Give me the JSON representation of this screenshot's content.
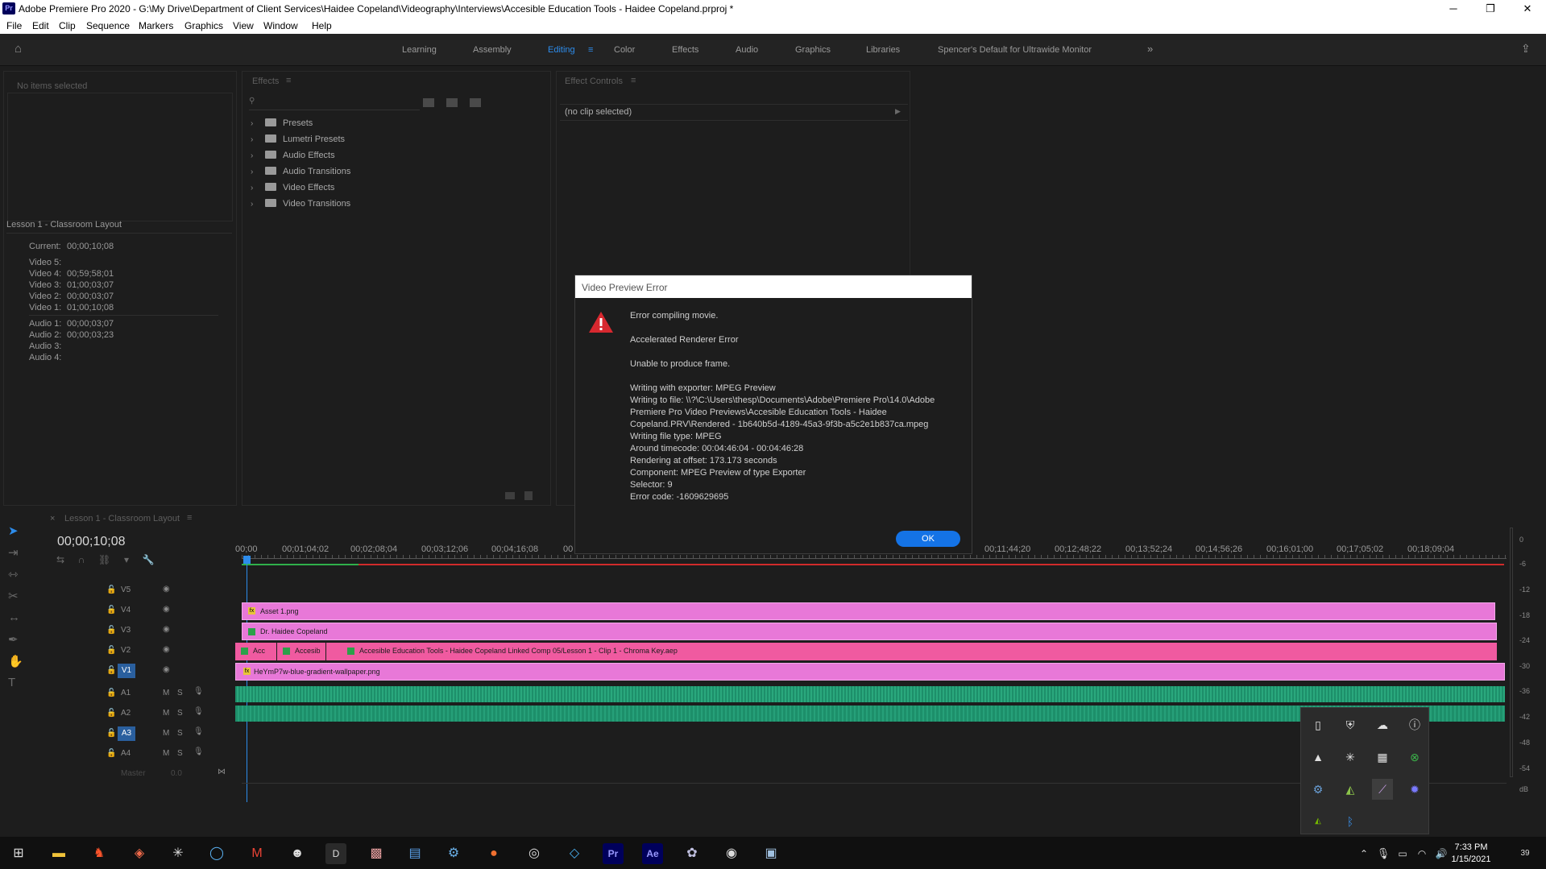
{
  "title_bar": {
    "app_icon": "Pr",
    "title": "Adobe Premiere Pro 2020 - G:\\My Drive\\Department of Client Services\\Haidee Copeland\\Videography\\Interviews\\Accesible Education Tools - Haidee Copeland.prproj *",
    "minimize": "─",
    "maximize": "❐",
    "close": "✕"
  },
  "menu": [
    "File",
    "Edit",
    "Clip",
    "Sequence",
    "Markers",
    "Graphics",
    "View",
    "Window",
    "Help"
  ],
  "workspaces": [
    "Learning",
    "Assembly",
    "Editing",
    "Color",
    "Effects",
    "Audio",
    "Graphics",
    "Libraries",
    "Spencer's Default for Ultrawide Monitor"
  ],
  "active_workspace": "Editing",
  "workspace_overflow": "»",
  "info_panel": {
    "no_items": "No items selected",
    "sequence_name": "Lesson 1 - Classroom Layout",
    "current_label": "Current:",
    "current_value": "00;00;10;08",
    "video": [
      {
        "label": "Video 5:",
        "value": ""
      },
      {
        "label": "Video 4:",
        "value": "00;59;58;01"
      },
      {
        "label": "Video 3:",
        "value": "01;00;03;07"
      },
      {
        "label": "Video 2:",
        "value": "00;00;03;07"
      },
      {
        "label": "Video 1:",
        "value": "01;00;10;08"
      }
    ],
    "audio": [
      {
        "label": "Audio 1:",
        "value": "00;00;03;07"
      },
      {
        "label": "Audio 2:",
        "value": "00;00;03;23"
      },
      {
        "label": "Audio 3:",
        "value": ""
      },
      {
        "label": "Audio 4:",
        "value": ""
      }
    ]
  },
  "effects_panel": {
    "title": "Effects",
    "items": [
      "Presets",
      "Lumetri Presets",
      "Audio Effects",
      "Audio Transitions",
      "Video Effects",
      "Video Transitions"
    ]
  },
  "effect_controls": {
    "title": "Effect Controls",
    "no_clip": "(no clip selected)"
  },
  "dialog": {
    "title": "Video Preview Error",
    "lines": [
      "Error compiling movie.",
      "Accelerated Renderer Error",
      "Unable to produce frame.",
      "Writing with exporter: MPEG Preview",
      "Writing to file: \\\\?\\C:\\Users\\thesp\\Documents\\Adobe\\Premiere Pro\\14.0\\Adobe",
      "Premiere Pro Video Previews\\Accesible Education Tools - Haidee",
      "Copeland.PRV\\Rendered - 1b640b5d-4189-45a3-9f3b-a5c2e1b837ca.mpeg",
      "Writing file type: MPEG",
      "Around timecode: 00:04:46:04 - 00:04:46:28",
      "Rendering at offset: 173.173 seconds",
      "Component: MPEG Preview of type Exporter",
      "Selector: 9",
      "Error code: -1609629695"
    ],
    "ok": "OK"
  },
  "timeline": {
    "tab": "Lesson 1 - Classroom Layout",
    "timecode": "00;00;10;08",
    "ruler": [
      "00;00",
      "00;01;04;02",
      "00;02;08;04",
      "00;03;12;06",
      "00;04;16;08",
      "00",
      "00;11;44;20",
      "00;12;48;22",
      "00;13;52;24",
      "00;14;56;26",
      "00;16;01;00",
      "00;17;05;02",
      "00;18;09;04"
    ],
    "video_tracks": [
      "V5",
      "V4",
      "V3",
      "V2",
      "V1"
    ],
    "audio_tracks": [
      "A1",
      "A2",
      "A3",
      "A4"
    ],
    "master": "Master",
    "master_value": "0.0",
    "clips": {
      "v4": "Asset 1.png",
      "v3": "Dr. Haidee Copeland",
      "v2a": "Acc",
      "v2b": "Accesib",
      "v2c": "Accesible Education Tools - Haidee Copeland Linked Comp 05/Lesson 1 - Clip 1 - Chroma Key.aep",
      "v1": "HeYmP7w-blue-gradient-wallpaper.png"
    },
    "meter_labels": [
      "0",
      "-6",
      "-12",
      "-18",
      "-24",
      "-30",
      "-36",
      "-42",
      "-48",
      "-54",
      "dB"
    ]
  },
  "tray_icons": [
    "usb-icon",
    "shield-icon",
    "cloud-icon",
    "info-icon",
    "drive-icon",
    "slack-icon",
    "app-icon",
    "xbox-icon",
    "steam-icon",
    "nvidia-icon",
    "feather-icon",
    "gear-icon",
    "nvidia-small-icon",
    "bluetooth-icon"
  ],
  "taskbar": {
    "time": "7:33 PM",
    "date": "1/15/2021",
    "notifications": "39"
  }
}
